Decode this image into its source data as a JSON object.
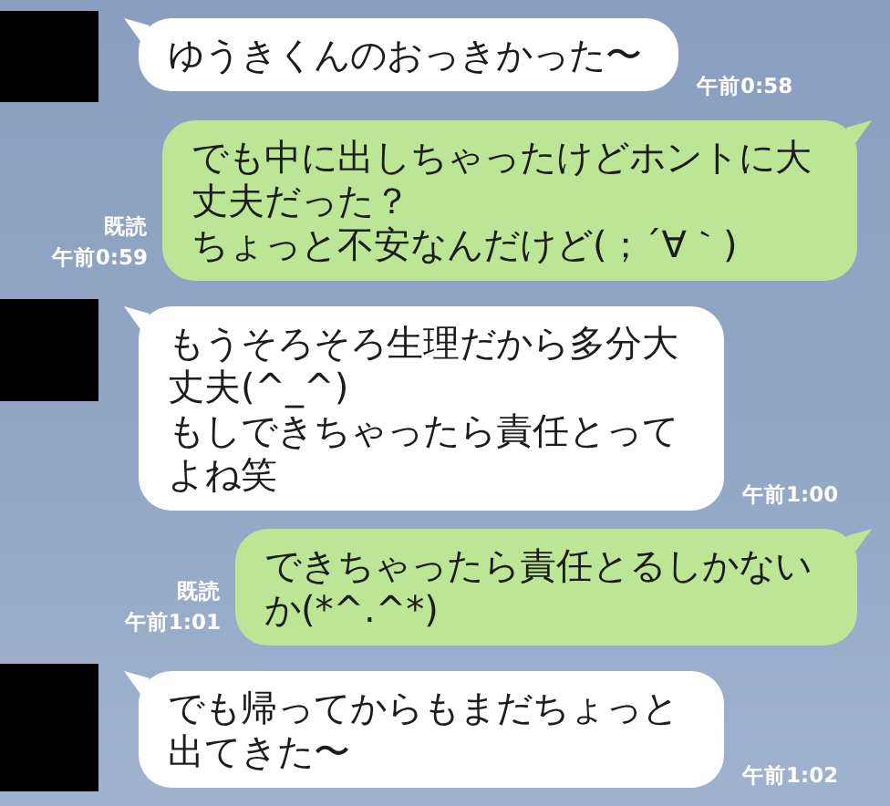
{
  "messages": [
    {
      "kind": "incoming",
      "lines": [
        "ゆうきくんのおっきかった〜"
      ],
      "time": "午前0:58"
    },
    {
      "kind": "outgoing",
      "lines": [
        "でも中に出しちゃったけどホントに大丈夫だった？",
        "ちょっと不安なんだけど(；´∀｀)"
      ],
      "read": "既読",
      "time": "午前0:59"
    },
    {
      "kind": "incoming",
      "lines": [
        "もうそろそろ生理だから多分大丈夫(^_^)",
        "もしできちゃったら責任とってよね笑"
      ],
      "time": "午前1:00"
    },
    {
      "kind": "outgoing",
      "lines": [
        "できちゃったら責任とるしかないか(*^.^*)"
      ],
      "read": "既読",
      "time": "午前1:01"
    },
    {
      "kind": "incoming",
      "lines": [
        "でも帰ってからもまだちょっと出てきた〜"
      ],
      "time": "午前1:02"
    }
  ]
}
